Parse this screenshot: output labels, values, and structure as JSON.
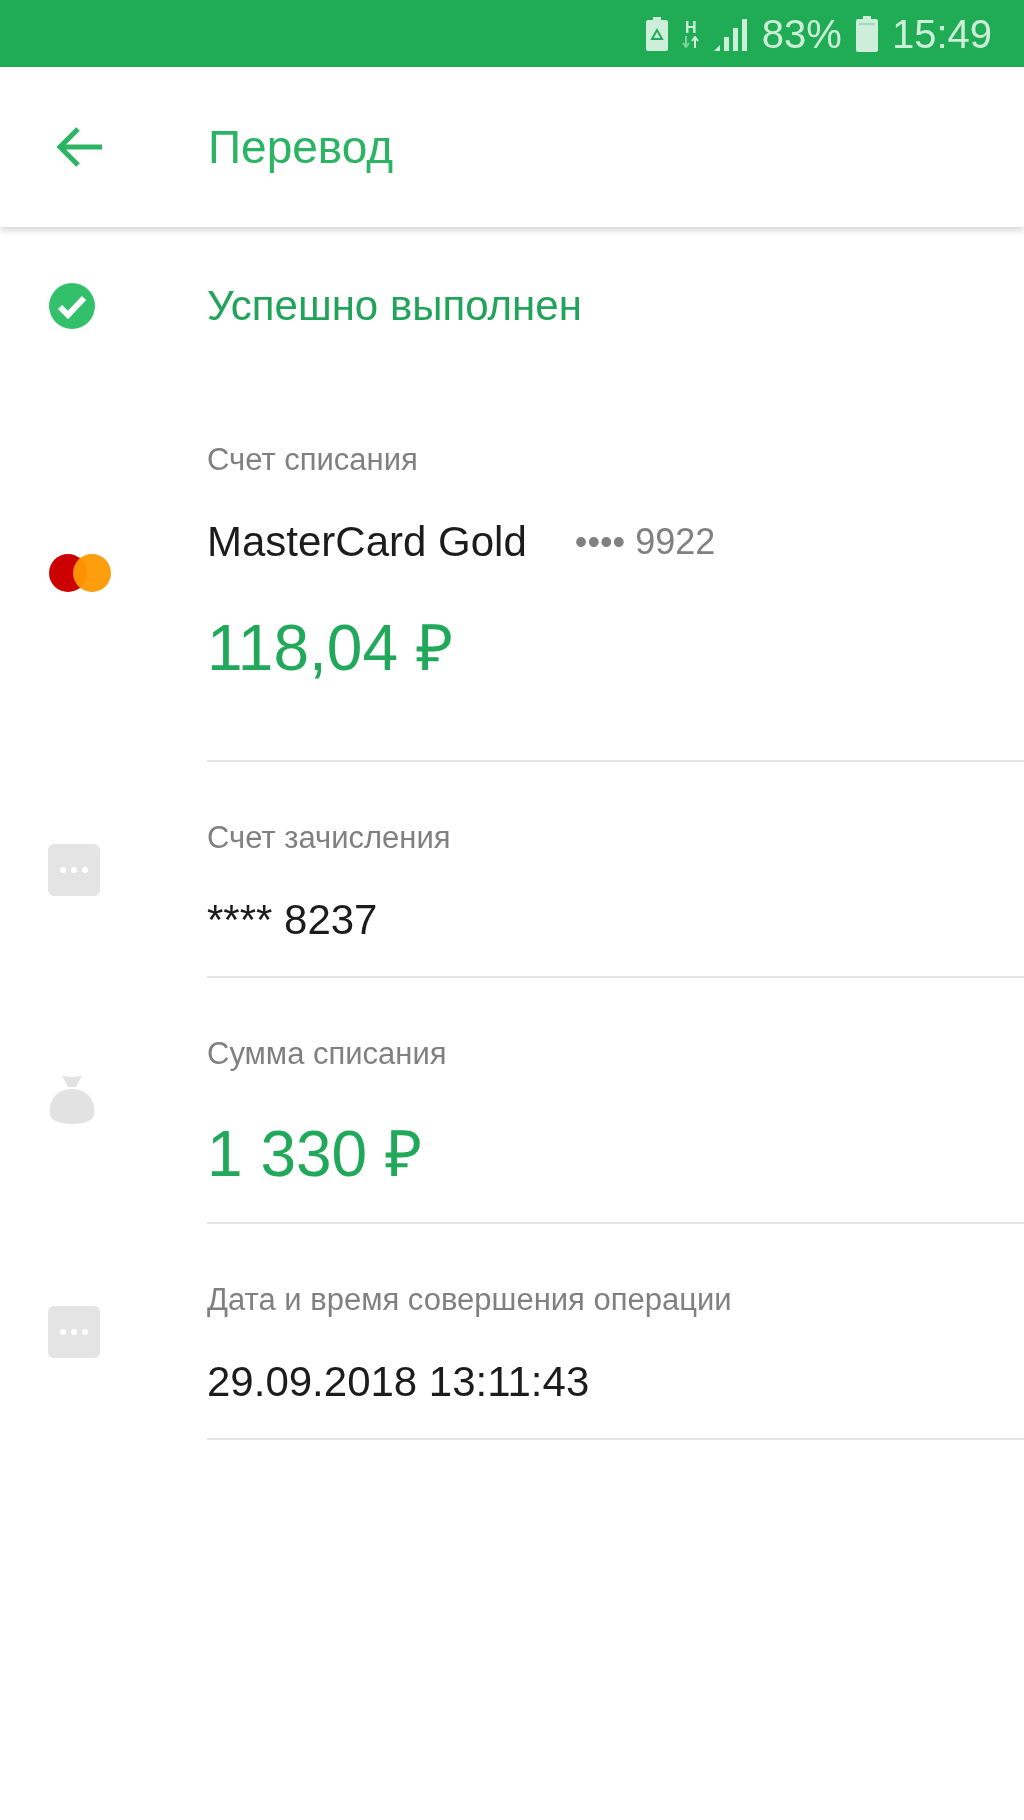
{
  "status_bar": {
    "network": "H",
    "battery": "83%",
    "time": "15:49"
  },
  "header": {
    "title": "Перевод"
  },
  "status": {
    "text": "Успешно выполнен"
  },
  "sections": [
    {
      "kind": "card",
      "label": "Счет списания",
      "name": "MasterCard Gold",
      "masked_number": "•••• 9922",
      "amount": "118,04 ₽"
    },
    {
      "kind": "account",
      "label": "Счет зачисления",
      "value": "**** 8237"
    },
    {
      "kind": "sum",
      "label": "Сумма списания",
      "amount": "1 330 ₽"
    },
    {
      "kind": "datetime",
      "label": "Дата и время совершения операции",
      "value": "29.09.2018 13:11:43"
    }
  ]
}
